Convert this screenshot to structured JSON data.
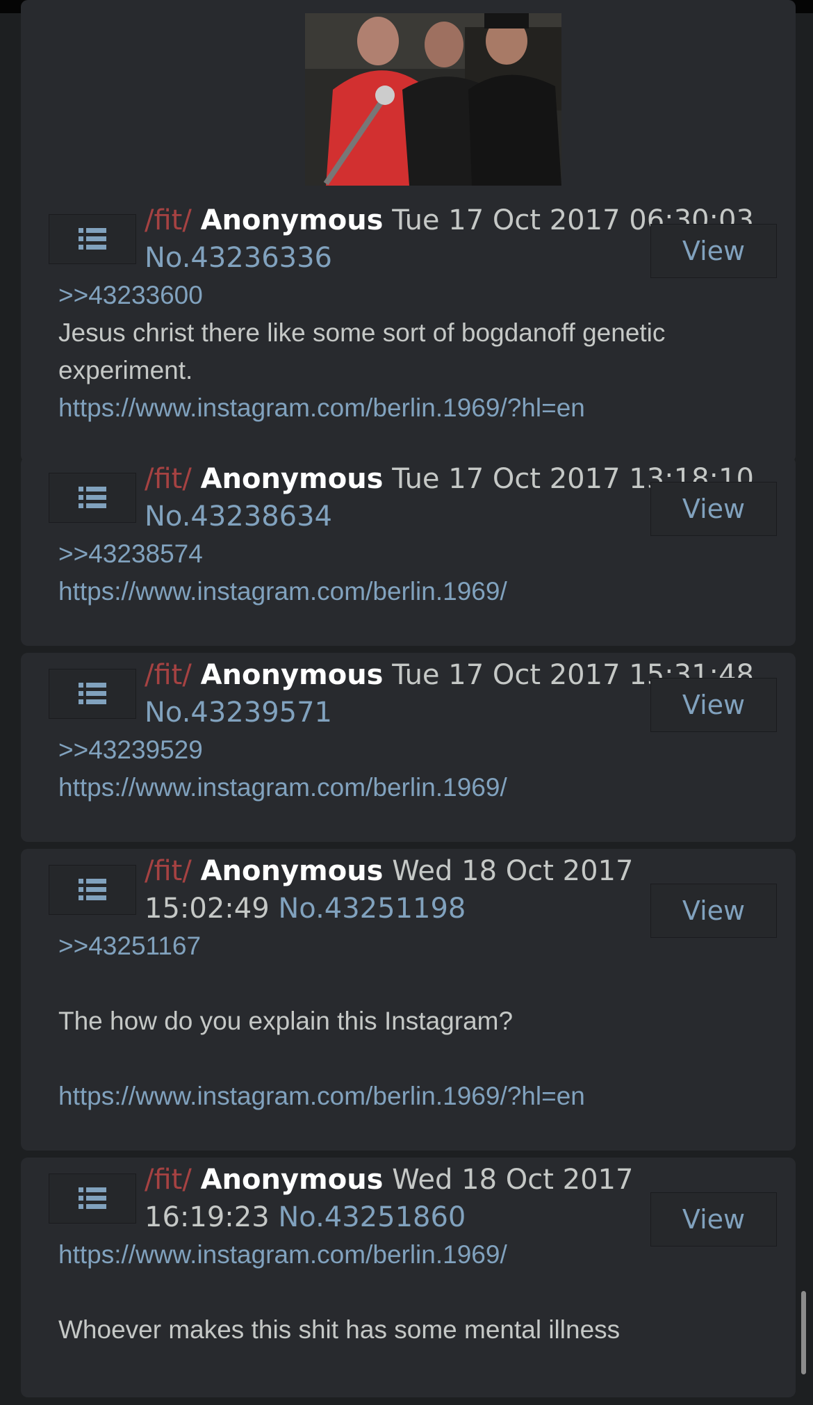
{
  "posts": [
    {
      "board": "/fit/",
      "name": "Anonymous",
      "date": "Tue 17 Oct 2017 06:30:03",
      "number": "No.43236336",
      "view_label": "View",
      "quote": ">>43233600",
      "text_line1": "Jesus christ there like some sort of bogdanoff genetic",
      "text_line2": "experiment.",
      "link": "https://www.instagram.com/berlin.1969/?hl=en"
    },
    {
      "board": "/fit/",
      "name": "Anonymous",
      "date": "Tue 17 Oct 2017 13:18:10",
      "number": "No.43238634",
      "view_label": "View",
      "quote": ">>43238574",
      "link": "https://www.instagram.com/berlin.1969/"
    },
    {
      "board": "/fit/",
      "name": "Anonymous",
      "date": "Tue 17 Oct 2017 15:31:48",
      "number": "No.43239571",
      "view_label": "View",
      "quote": ">>43239529",
      "link": "https://www.instagram.com/berlin.1969/"
    },
    {
      "board": "/fit/",
      "name": "Anonymous",
      "date_part1": "Wed 18 Oct 2017",
      "date_part2": "15:02:49",
      "number": "No.43251198",
      "view_label": "View",
      "quote": ">>43251167",
      "text": "The how do you explain this Instagram?",
      "link": "https://www.instagram.com/berlin.1969/?hl=en"
    },
    {
      "board": "/fit/",
      "name": "Anonymous",
      "date_part1": "Wed 18 Oct 2017",
      "date_part2": "16:19:23",
      "number": "No.43251860",
      "view_label": "View",
      "link": "https://www.instagram.com/berlin.1969/",
      "text": "Whoever makes this shit has some mental illness"
    }
  ],
  "icons": {
    "menu": "list-icon"
  },
  "colors": {
    "background": "#1d1f21",
    "post_bg": "#282a2e",
    "board": "#a54242",
    "link": "#81a2be",
    "text": "#c5c8c6"
  }
}
